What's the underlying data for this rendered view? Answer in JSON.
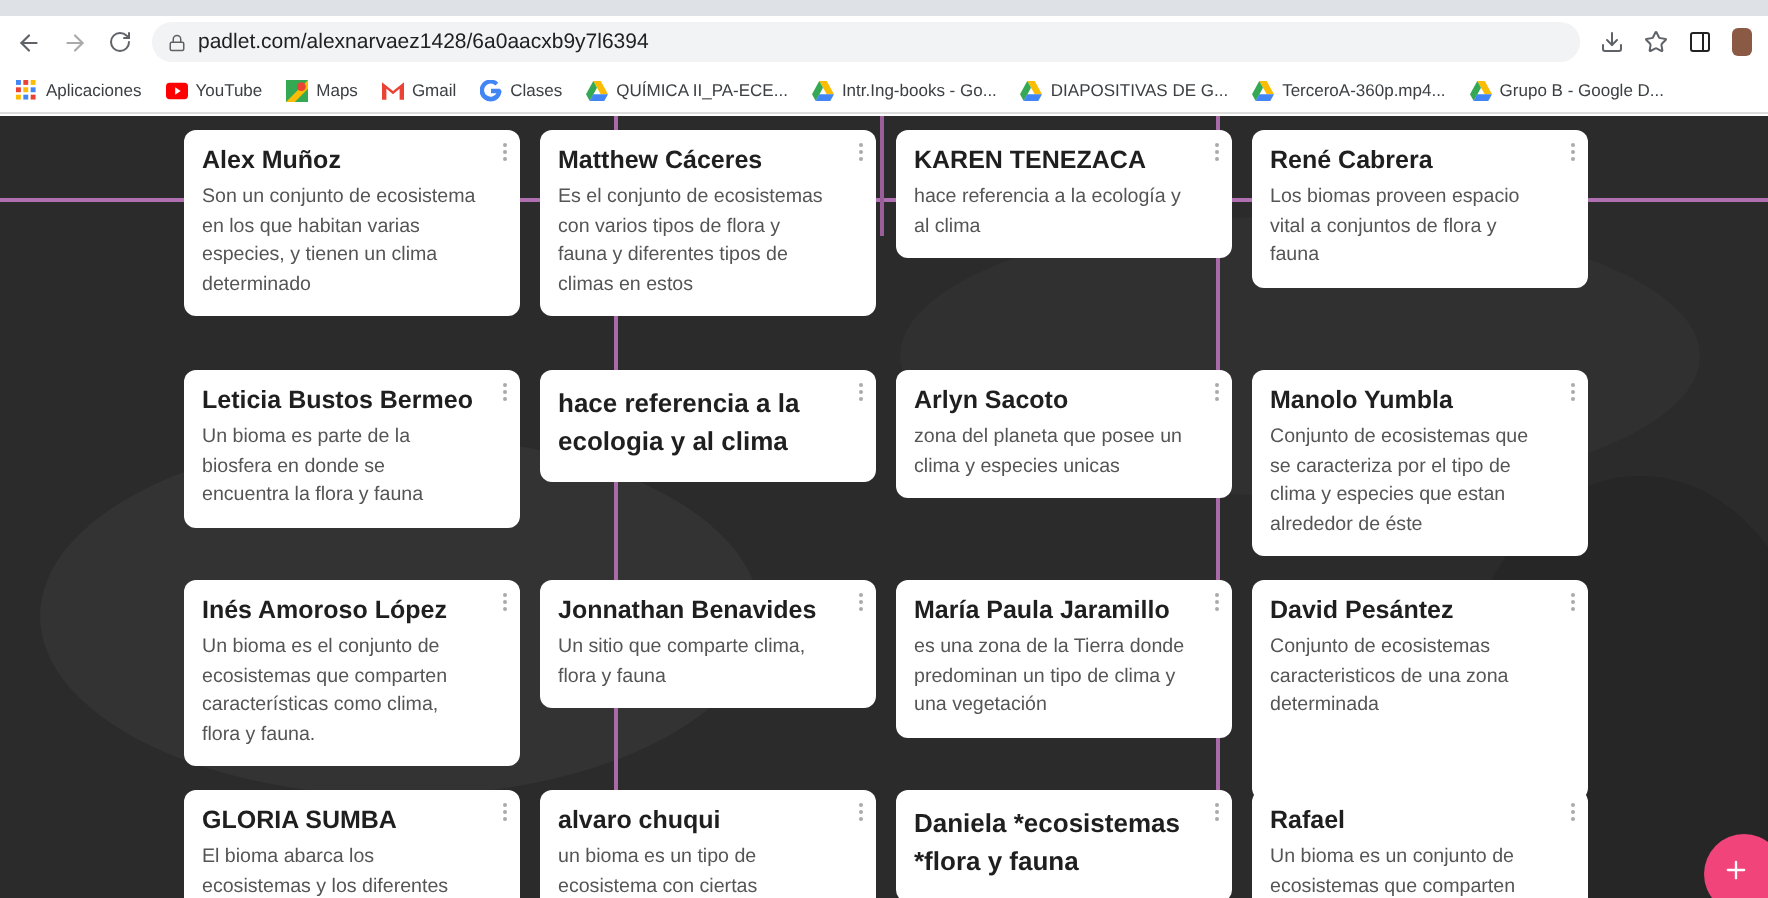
{
  "browser": {
    "url": "padlet.com/alexnarvaez1428/6a0aacxb9y7l6394",
    "bookmarks": [
      {
        "label": "Aplicaciones",
        "kind": "apps"
      },
      {
        "label": "YouTube",
        "kind": "youtube"
      },
      {
        "label": "Maps",
        "kind": "maps"
      },
      {
        "label": "Gmail",
        "kind": "gmail"
      },
      {
        "label": "Clases",
        "kind": "google"
      },
      {
        "label": "QUÍMICA II_PA-ECE...",
        "kind": "drive"
      },
      {
        "label": "Intr.Ing-books - Go...",
        "kind": "drive"
      },
      {
        "label": "DIAPOSITIVAS DE G...",
        "kind": "drive"
      },
      {
        "label": "TerceroA-360p.mp4...",
        "kind": "drive"
      },
      {
        "label": "Grupo B - Google D...",
        "kind": "drive"
      }
    ]
  },
  "posts": [
    {
      "title": "Alex Muñoz",
      "body": "Son un conjunto de ecosistema en los que habitan varias especies, y tienen un clima determinado",
      "kind": "note"
    },
    {
      "title": "Matthew Cáceres",
      "body": "Es el conjunto de ecosistemas con varios tipos de flora y fauna y diferentes tipos de climas en estos",
      "kind": "note"
    },
    {
      "title": "KAREN TENEZACA",
      "body": "hace referencia a la ecología y al clima",
      "kind": "note"
    },
    {
      "title": "René Cabrera",
      "body": "Los biomas proveen espacio vital a conjuntos de flora y fauna",
      "kind": "note"
    },
    {
      "title": "Leticia Bustos Bermeo",
      "body": "Un bioma es parte de la biosfera en donde se encuentra la flora y fauna",
      "kind": "note"
    },
    {
      "title": "hace referencia a la ecologia y al clima",
      "kind": "heading"
    },
    {
      "title": "Arlyn Sacoto",
      "body": "zona del planeta que posee un clima y especies unicas",
      "kind": "note"
    },
    {
      "title": "Manolo Yumbla",
      "body": "Conjunto de ecosistemas que se caracteriza por el tipo de clima y especies que estan alrededor de éste",
      "kind": "note"
    },
    {
      "title": "Inés Amoroso López",
      "body": "Un bioma es el conjunto de ecosistemas que comparten características como clima, flora y fauna.",
      "kind": "note"
    },
    {
      "title": "Jonnathan Benavides",
      "body": "Un sitio que comparte clima, flora y fauna",
      "kind": "note"
    },
    {
      "title": "María Paula Jaramillo",
      "body": "es una zona de la Tierra donde predominan un tipo de clima y una vegetación",
      "kind": "note"
    },
    {
      "title": "David Pesántez",
      "body": "Conjunto de ecosistemas caracteristicos de una zona determinada",
      "kind": "note"
    },
    {
      "title": "GLORIA SUMBA",
      "body": "El bioma abarca los ecosistemas y los diferentes",
      "kind": "note"
    },
    {
      "title": "alvaro chuqui",
      "body": "un bioma es un tipo de ecosistema con ciertas",
      "kind": "note"
    },
    {
      "title": "Daniela *ecosistemas *flora y fauna",
      "kind": "heading"
    },
    {
      "title": "Rafael",
      "body": "Un bioma es un conjunto de ecosistemas que comparten",
      "kind": "note"
    }
  ]
}
